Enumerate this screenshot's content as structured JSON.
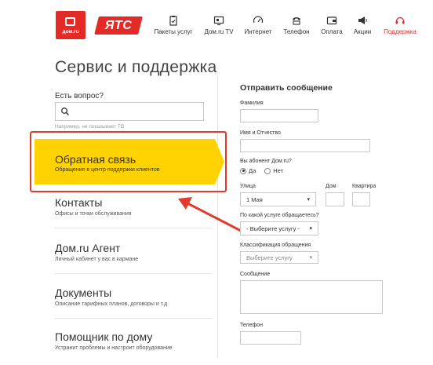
{
  "header": {
    "logo_domru": "дом.ru",
    "logo_yats": "ЯТС",
    "nav": [
      {
        "label": "Пакеты услуг",
        "icon": "clipboard-icon"
      },
      {
        "label": "Дом.ru TV",
        "icon": "tv-icon"
      },
      {
        "label": "Интернет",
        "icon": "speedometer-icon"
      },
      {
        "label": "Телефон",
        "icon": "phone-icon"
      },
      {
        "label": "Оплата",
        "icon": "wallet-icon"
      },
      {
        "label": "Акции",
        "icon": "megaphone-icon"
      },
      {
        "label": "Поддержка",
        "icon": "headset-icon",
        "active": true
      }
    ]
  },
  "sidebar": {
    "title": "Сервис и поддержка",
    "question_label": "Есть вопрос?",
    "search_placeholder": "",
    "search_hint": "Например, не показывает ТВ",
    "items": [
      {
        "title": "Обратная связь",
        "subtitle": "Обращение в центр поддержки клиентов",
        "highlighted": true
      },
      {
        "title": "Контакты",
        "subtitle": "Офисы и точки обслуживания"
      },
      {
        "title": "Дом.ru Агент",
        "subtitle": "Личный кабинет у вас в кармане"
      },
      {
        "title": "Документы",
        "subtitle": "Описание тарифных планов, договоры и т.д"
      },
      {
        "title": "Помощник по дому",
        "subtitle": "Устранит проблемы и настроит оборудование"
      }
    ]
  },
  "form": {
    "title": "Отправить сообщение",
    "surname_label": "Фамилия",
    "surname_value": "",
    "name_label": "Имя и Отчество",
    "name_value": "",
    "subscriber_label": "Вы абонент Дом.ru?",
    "subscriber_yes": "Да",
    "subscriber_no": "Нет",
    "street_label": "Улица",
    "street_value": "1 Мая",
    "house_label": "Дом",
    "apartment_label": "Квартира",
    "service_label": "По какой услуге обращаетесь?",
    "service_value": "- Выберите услугу -",
    "classification_label": "Классификация обращения",
    "classification_value": "Выберите услугу",
    "message_label": "Сообщение",
    "phone_label": "Телефон"
  },
  "colors": {
    "brand_red": "#e32a27",
    "highlight_yellow": "#ffd200",
    "annotation_red": "#e23b2e"
  }
}
